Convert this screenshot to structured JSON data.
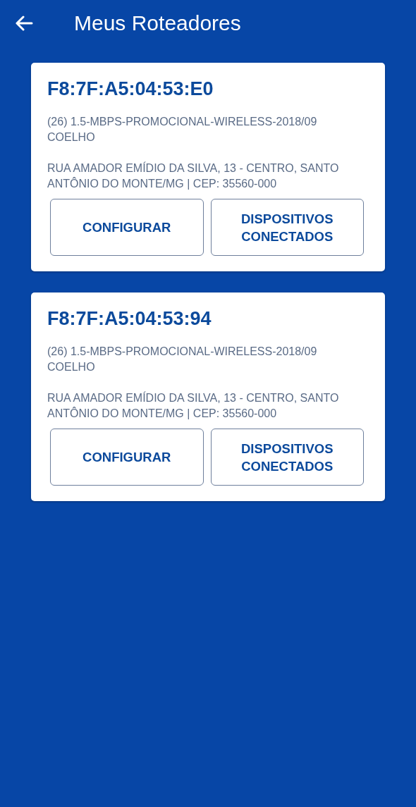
{
  "app_bar": {
    "title": "Meus Roteadores"
  },
  "routers": [
    {
      "mac": "F8:7F:A5:04:53:E0",
      "plan": "(26) 1.5-MBPS-PROMOCIONAL-WIRELESS-2018/09 COELHO",
      "address": "RUA AMADOR EMÍDIO DA SILVA, 13 - CENTRO, SANTO ANTÔNIO DO MONTE/MG | CEP: 35560-000",
      "buttons": [
        "CONFIGURAR",
        "DISPOSITIVOS CONECTADOS"
      ]
    },
    {
      "mac": "F8:7F:A5:04:53:94",
      "plan": "(26) 1.5-MBPS-PROMOCIONAL-WIRELESS-2018/09 COELHO",
      "address": "RUA AMADOR EMÍDIO DA SILVA, 13 - CENTRO, SANTO ANTÔNIO DO MONTE/MG | CEP: 35560-000",
      "buttons": [
        "CONFIGURAR",
        "DISPOSITIVOS CONECTADOS"
      ]
    }
  ]
}
